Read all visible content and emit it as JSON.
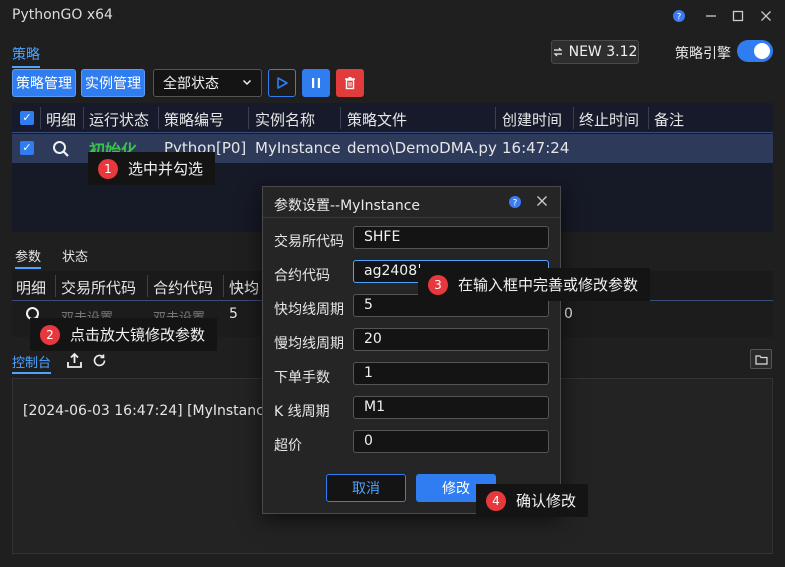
{
  "window": {
    "title": "PythonGO x64"
  },
  "top_tab": "策略",
  "version": "NEW 3.12",
  "engine_label": "策略引擎",
  "toolbar": {
    "strategy_mgmt": "策略管理",
    "instance_mgmt": "实例管理",
    "status_select": "全部状态"
  },
  "table1": {
    "headers": [
      "明细",
      "运行状态",
      "策略编号",
      "实例名称",
      "策略文件",
      "创建时间",
      "终止时间",
      "备注"
    ],
    "row": {
      "status": "初始化",
      "strategy_id": "Python[P0]",
      "instance": "MyInstance",
      "file": "demo\\DemoDMA.py",
      "created": "16:47:24"
    }
  },
  "lower_tabs": [
    "参数",
    "状态"
  ],
  "table2": {
    "headers": [
      "明细",
      "交易所代码",
      "合约代码",
      "快均"
    ],
    "row": {
      "exchange": "双击设置",
      "contract": "双击设置",
      "fast": "5",
      "last": "0"
    }
  },
  "console": {
    "tab": "控制台",
    "line": "[2024-06-03 16:47:24] [MyInstance]"
  },
  "callouts": [
    {
      "num": "1",
      "text": "选中并勾选"
    },
    {
      "num": "2",
      "text": "点击放大镜修改参数"
    },
    {
      "num": "3",
      "text": "在输入框中完善或修改参数"
    },
    {
      "num": "4",
      "text": "确认修改"
    }
  ],
  "dialog": {
    "title": "参数设置--MyInstance",
    "fields": [
      {
        "label": "交易所代码",
        "value": "SHFE"
      },
      {
        "label": "合约代码",
        "value": "ag2408"
      },
      {
        "label": "快均线周期",
        "value": "5"
      },
      {
        "label": "慢均线周期",
        "value": "20"
      },
      {
        "label": "下单手数",
        "value": "1"
      },
      {
        "label": "K 线周期",
        "value": "M1"
      },
      {
        "label": "超价",
        "value": "0"
      }
    ],
    "cancel": "取消",
    "confirm": "修改"
  },
  "colors": {
    "accent": "#2f7df0",
    "status_green": "#39c24a",
    "badge_red": "#e8383d",
    "delete_red": "#e23b3b"
  }
}
